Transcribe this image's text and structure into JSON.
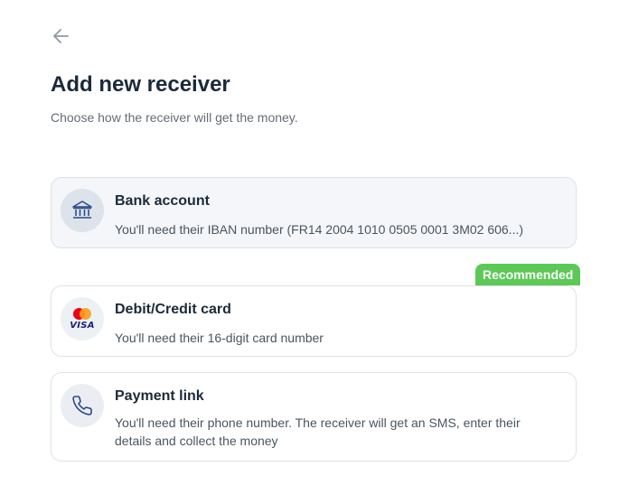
{
  "header": {
    "back_icon": "arrow-left-icon",
    "title": "Add new receiver",
    "subtitle": "Choose how the receiver will get the money."
  },
  "options": [
    {
      "icon": "bank-icon",
      "title": "Bank account",
      "description": "You'll need their IBAN number (FR14 2004 1010 0505 0001 3M02 606...)",
      "selected": true
    },
    {
      "icon": "visa-mastercard-icon",
      "title": "Debit/Credit card",
      "description": "You'll need their 16-digit card number",
      "badge": "Recommended",
      "card_brand_text": "VISA"
    },
    {
      "icon": "phone-icon",
      "title": "Payment link",
      "description": "You'll need their phone number. The receiver will get an SMS, enter their details and collect the money"
    }
  ],
  "colors": {
    "title": "#1b2a3a",
    "badge": "#5cc957",
    "border": "#dde2e7",
    "icon": "#2a4a8a"
  }
}
